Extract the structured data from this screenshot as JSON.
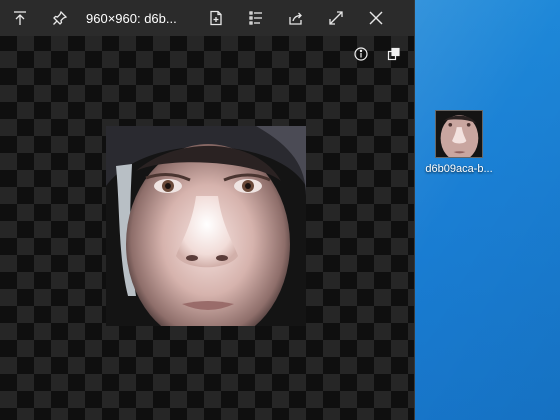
{
  "viewer": {
    "title": "960×960: d6b...",
    "toolbar": {
      "move_top_icon": "move-to-top-icon",
      "pin_icon": "pin-icon",
      "save_icon": "save-file-icon",
      "list_icon": "list-icon",
      "share_icon": "share-icon",
      "fullscreen_icon": "expand-icon",
      "close_icon": "close-icon"
    },
    "overlay": {
      "info_icon": "info-icon",
      "mode_icon": "switch-mode-icon"
    },
    "image": {
      "description_icon": "photo-face-image",
      "background": "#141414"
    }
  },
  "desktop": {
    "icon_label": "d6b09aca-b...",
    "accent": "#1a7fd4"
  }
}
